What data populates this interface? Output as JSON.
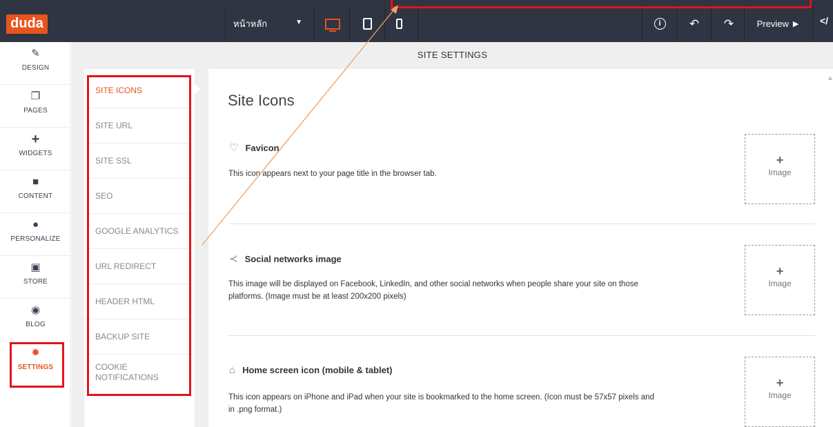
{
  "topbar": {
    "logo": "duda",
    "page_select": "หน้าหลัก",
    "preview_label": "Preview",
    "code_label": "</"
  },
  "rail": {
    "items": [
      {
        "label": "DESIGN",
        "icon": "brush-icon"
      },
      {
        "label": "PAGES",
        "icon": "pages-icon"
      },
      {
        "label": "WIDGETS",
        "icon": "plus-icon"
      },
      {
        "label": "CONTENT",
        "icon": "folder-icon"
      },
      {
        "label": "PERSONALIZE",
        "icon": "person-icon"
      },
      {
        "label": "STORE",
        "icon": "cart-icon"
      },
      {
        "label": "BLOG",
        "icon": "comment-icon"
      },
      {
        "label": "SETTINGS",
        "icon": "gear-icon",
        "active": true
      }
    ]
  },
  "settings": {
    "title": "SITE SETTINGS",
    "menu": [
      {
        "label": "SITE ICONS",
        "active": true
      },
      {
        "label": "SITE URL"
      },
      {
        "label": "SITE SSL"
      },
      {
        "label": "SEO"
      },
      {
        "label": "GOOGLE ANALYTICS"
      },
      {
        "label": "URL REDIRECT"
      },
      {
        "label": "HEADER HTML"
      },
      {
        "label": "BACKUP SITE"
      },
      {
        "label": "COOKIE NOTIFICATIONS"
      }
    ]
  },
  "panel": {
    "title": "Site Icons",
    "sections": [
      {
        "icon": "heart-icon",
        "title": "Favicon",
        "description": "This icon appears next to your page title in the browser tab.",
        "upload_plus": "+",
        "upload_label": "Image"
      },
      {
        "icon": "share-icon",
        "title": "Social networks image",
        "description": "This image will be displayed on Facebook, LinkedIn, and other social networks when people share your site on those platforms. (Image must be at least 200x200 pixels)",
        "upload_plus": "+",
        "upload_label": "Image"
      },
      {
        "icon": "home-icon",
        "title": "Home screen icon (mobile & tablet)",
        "description": "This icon appears on iPhone and iPad when your site is bookmarked to the home screen. (Icon must be 57x57 pixels and in .png format.)",
        "upload_plus": "+",
        "upload_label": "Image"
      }
    ]
  },
  "colors": {
    "accent": "#e8541e",
    "topbar": "#2f3542",
    "annotation": "#e0141a",
    "arrow": "#f0a060"
  }
}
